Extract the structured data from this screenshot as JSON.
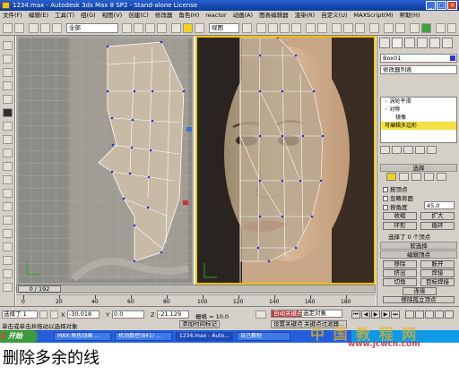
{
  "window": {
    "title": "1234.max - Autodesk 3ds Max 8 SP2 - Stand-alone License",
    "minimize": "_",
    "maximize": "□",
    "close": "×"
  },
  "menu": [
    "文件(F)",
    "编辑(E)",
    "工具(T)",
    "组(G)",
    "视图(V)",
    "创建(C)",
    "修改器",
    "角色(H)",
    "reactor",
    "动画(A)",
    "图表编辑器",
    "渲染(R)",
    "自定义(U)",
    "MAXScript(M)",
    "帮助(H)"
  ],
  "toolbar": {
    "selection_filter": "全部",
    "ref_coord": "视图"
  },
  "viewports": {
    "left_label": "",
    "right_label": ""
  },
  "command_panel": {
    "object_name": "Box01",
    "modifier_list": "修改器列表",
    "stack": [
      {
        "label": "◦ 涡轮平滑",
        "level": 0,
        "selected": false
      },
      {
        "label": "◦ 对称",
        "level": 0,
        "selected": false
      },
      {
        "label": "镜像",
        "level": 2,
        "selected": false
      },
      {
        "label": "可编辑多边形",
        "level": 0,
        "selected": true
      }
    ],
    "selection": {
      "rollout": "选择",
      "by_vertex": "按顶点",
      "ignore_backfacing": "忽略背面",
      "by_angle": "按角度",
      "angle_value": "45.0",
      "shrink": "收缩",
      "grow": "扩大",
      "ring": "环形",
      "loop": "循环",
      "status": "选择了 0 个顶点"
    },
    "soft_selection": "软选择",
    "edit_vertices": {
      "rollout": "编辑顶点",
      "remove": "移除",
      "break": "断开",
      "extrude": "挤出",
      "weld": "焊接",
      "chamfer": "切角",
      "target_weld": "目标焊接",
      "connect": "连接",
      "remove_isolated": "移除孤立顶点",
      "remove_unused_map": "移除未使用的贴图顶点",
      "weight_label": "权重:",
      "weight_value": "1.0",
      "edit_geometry": "编辑几何体"
    }
  },
  "timeline": {
    "slider": "0 / 192",
    "ticks": [
      "0",
      "20",
      "40",
      "60",
      "80",
      "100",
      "120",
      "140",
      "160",
      "180"
    ]
  },
  "status": {
    "selected": "选择了 1",
    "x_label": "X",
    "x_value": "-30.018",
    "y_label": "Y",
    "y_value": "0.0",
    "z_label": "Z",
    "z_value": "-21.129",
    "grid": "栅格 = 10.0",
    "auto_key": "自动关键点",
    "set_key": "设置关键点",
    "key_filter_target": "选定对象",
    "key_filters": "关键点过滤器...",
    "prompt": "单击或单击并拖动以选择对象",
    "add_time_tag": "添加时间标记"
  },
  "taskbar": {
    "start": "开始",
    "tasks": [
      "MAX-角色动画 ...",
      "机动数控(841) ...",
      "1234.max - Auto...",
      "自己教程"
    ],
    "watermark_text": "中 国 教 程 网",
    "watermark_url": "www.jcwcn.com"
  },
  "caption": "删除多余的线"
}
